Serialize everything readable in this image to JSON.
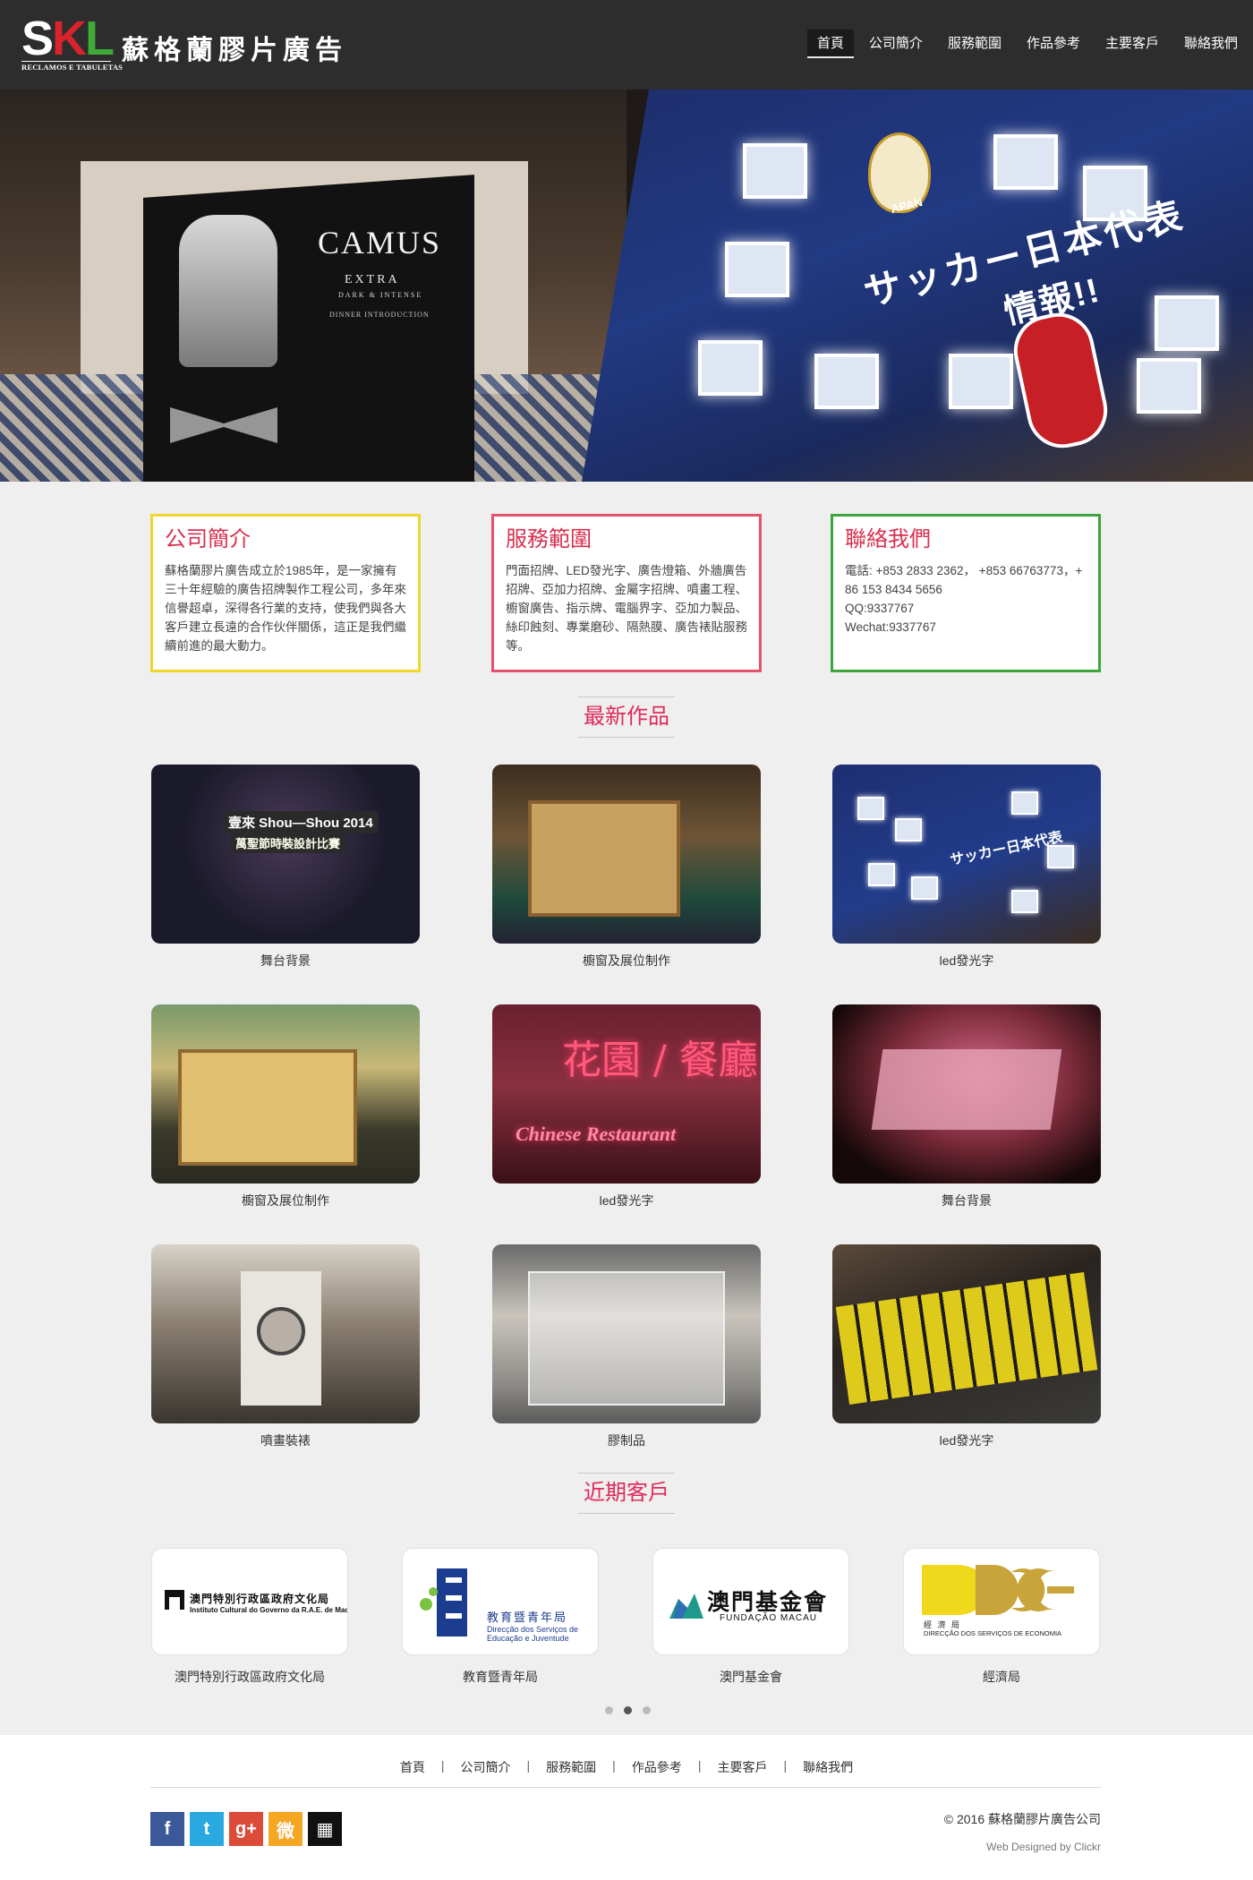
{
  "brand": {
    "logo_letters": [
      "S",
      "K",
      "L"
    ],
    "logo_subtitle": "RECLAMOS E TABULETAS",
    "company_name": "蘇格蘭膠片廣告",
    "colors": {
      "s": "#ffffff",
      "k": "#d9232d",
      "l": "#3faa35"
    }
  },
  "nav": {
    "items": [
      {
        "label": "首頁",
        "active": true
      },
      {
        "label": "公司簡介"
      },
      {
        "label": "服務範圍"
      },
      {
        "label": "作品參考"
      },
      {
        "label": "主要客戶"
      },
      {
        "label": "聯絡我們"
      }
    ]
  },
  "banner": {
    "camus_title": "CAMUS",
    "camus_extra": "EXTRA",
    "camus_dark": "DARK & INTENSE",
    "camus_dinner": "DINNER INTRODUCTION",
    "jp_apan": "APAN",
    "jp_title": "サッカー日本代表",
    "jp_sub": "情報!!"
  },
  "info": {
    "about": {
      "title": "公司簡介",
      "body": "蘇格蘭膠片廣告成立於1985年，是一家擁有三十年經驗的廣告招牌製作工程公司，多年來信譽超卓，深得各行業的支持，使我們與各大客戶建立長遠的合作伙伴關係，這正是我們繼續前進的最大動力。",
      "border_color": "#efd72b"
    },
    "services": {
      "title": "服務範圍",
      "body": "門面招牌、LED發光字、廣告燈箱、外牆廣告招牌、亞加力招牌、金屬字招牌、噴畫工程、櫥窗廣告、指示牌、電腦界字、亞加力製品、絲印蝕刻、專業磨砂、隔熱膜、廣告裱貼服務等。",
      "border_color": "#e5526a"
    },
    "contact": {
      "title": "聯絡我們",
      "phone": "電話: +853 2833 2362， +853 66763773，+86 153 8434 5656",
      "qq": "QQ:9337767",
      "wechat": "Wechat:9337767",
      "border_color": "#3aa63c"
    }
  },
  "works": {
    "heading": "最新作品",
    "items": [
      {
        "label": "舞台背景",
        "caption1": "壹來 Shou—Shou 2014",
        "caption2": "萬聖節時裝設計比賽"
      },
      {
        "label": "櫥窗及展位制作"
      },
      {
        "label": "led發光字",
        "caption1": "サッカー日本代表"
      },
      {
        "label": "櫥窗及展位制作"
      },
      {
        "label": "led發光字",
        "caption1": "花園 / 餐廳",
        "caption2": "Chinese Restaurant"
      },
      {
        "label": "舞台背景"
      },
      {
        "label": "噴畫裝裱"
      },
      {
        "label": "膠制品"
      },
      {
        "label": "led發光字"
      }
    ]
  },
  "clients": {
    "heading": "近期客戶",
    "items": [
      {
        "label": "澳門特別行政區政府文化局",
        "logo_title": "澳門特別行政區政府文化局",
        "logo_sub": "Instituto Cultural do Governo da R.A.E. de Macau"
      },
      {
        "label": "教育暨青年局",
        "logo_title": "教育暨青年局",
        "logo_sub1": "Direcção dos Serviços de",
        "logo_sub2": "Educação e Juventude"
      },
      {
        "label": "澳門基金會",
        "logo_title": "澳門基金會",
        "logo_sub": "FUNDAÇÃO MACAU"
      },
      {
        "label": "經濟局",
        "logo_title": "經 濟 局",
        "logo_sub": "DIRECÇÃO DOS SERVIÇOS DE ECONOMIA"
      }
    ],
    "carousel_pages": 3,
    "carousel_active": 2
  },
  "footer": {
    "nav": [
      "首頁",
      "公司簡介",
      "服務範圍",
      "作品參考",
      "主要客戶",
      "聯絡我們"
    ],
    "separator": "|",
    "social": [
      {
        "name": "facebook-icon",
        "glyph": "f"
      },
      {
        "name": "twitter-icon",
        "glyph": "t"
      },
      {
        "name": "google-plus-icon",
        "glyph": "g+"
      },
      {
        "name": "weibo-icon",
        "glyph": "微"
      },
      {
        "name": "qr-code-icon",
        "glyph": "▦"
      }
    ],
    "copyright": "© 2016 蘇格蘭膠片廣告公司",
    "designed_by": "Web Designed by Clickr"
  }
}
